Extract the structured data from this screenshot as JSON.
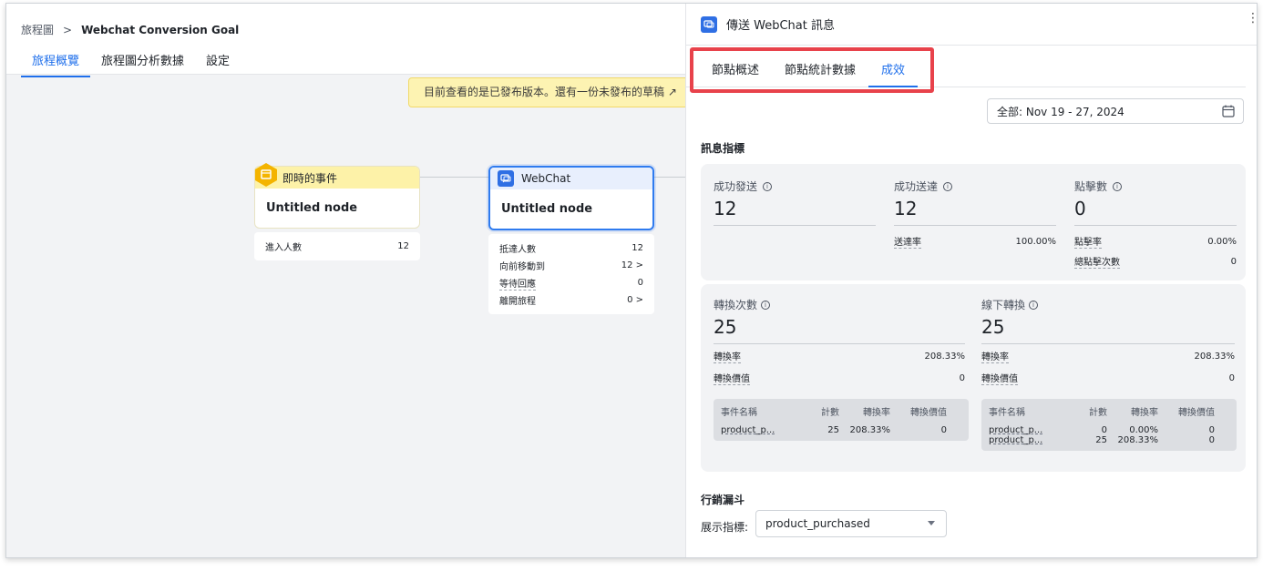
{
  "breadcrumb": {
    "root": "旅程圖",
    "separator": ">",
    "current": "Webchat Conversion Goal"
  },
  "main_tabs": [
    {
      "label": "旅程概覽",
      "active": true
    },
    {
      "label": "旅程圖分析數據",
      "active": false
    },
    {
      "label": "設定",
      "active": false
    }
  ],
  "banner": {
    "text": "目前查看的是已發布版本。還有一份未發布的草稿 ↗"
  },
  "nodes": {
    "event": {
      "type_label": "即時的事件",
      "title": "Untitled node",
      "stats": [
        {
          "label": "進入人數",
          "value": "12"
        }
      ]
    },
    "webchat": {
      "type_label": "WebChat",
      "title": "Untitled node",
      "stats": [
        {
          "label": "抵達人數",
          "value": "12"
        },
        {
          "label": "向前移動到",
          "value": "12 >"
        },
        {
          "label": "等待回應",
          "value": "0"
        },
        {
          "label": "離開旅程",
          "value": "0 >"
        }
      ]
    }
  },
  "panel": {
    "title": "傳送 WebChat 訊息",
    "tabs": [
      {
        "label": "節點概述",
        "active": false
      },
      {
        "label": "節點統計數據",
        "active": false
      },
      {
        "label": "成效",
        "active": true
      }
    ],
    "date_range": "全部: Nov 19 - 27, 2024",
    "message_metrics_title": "訊息指標",
    "metrics": {
      "sent": {
        "label": "成功發送",
        "value": "12"
      },
      "delivered": {
        "label": "成功送達",
        "value": "12",
        "sub_label": "送達率",
        "sub_value": "100.00%"
      },
      "clicks": {
        "label": "點擊數",
        "value": "0",
        "sub1_label": "點擊率",
        "sub1_value": "0.00%",
        "sub2_label": "總點擊次數",
        "sub2_value": "0"
      }
    },
    "conversions": {
      "online": {
        "label": "轉換次數",
        "value": "25",
        "rate_label": "轉換率",
        "rate_value": "208.33%",
        "worth_label": "轉換價值",
        "worth_value": "0",
        "table": {
          "headers": [
            "事件名稱",
            "計數",
            "轉換率",
            "轉換價值"
          ],
          "rows": [
            [
              "product_p...",
              "25",
              "208.33%",
              "0"
            ]
          ]
        }
      },
      "offline": {
        "label": "線下轉換",
        "value": "25",
        "rate_label": "轉換率",
        "rate_value": "208.33%",
        "worth_label": "轉換價值",
        "worth_value": "0",
        "table": {
          "headers": [
            "事件名稱",
            "計數",
            "轉換率",
            "轉換價值"
          ],
          "rows": [
            [
              "product_p...",
              "0",
              "0.00%",
              "0"
            ],
            [
              "product_p...",
              "25",
              "208.33%",
              "0"
            ]
          ]
        }
      }
    },
    "funnel_title": "行銷漏斗",
    "funnel_metric_label": "展示指標:",
    "funnel_metric_value": "product_purchased"
  },
  "colors": {
    "accent": "#1f6feb",
    "highlight": "#e8424b",
    "event_yellow": "#fdf2a8",
    "banner_yellow": "#fdf3b2"
  }
}
